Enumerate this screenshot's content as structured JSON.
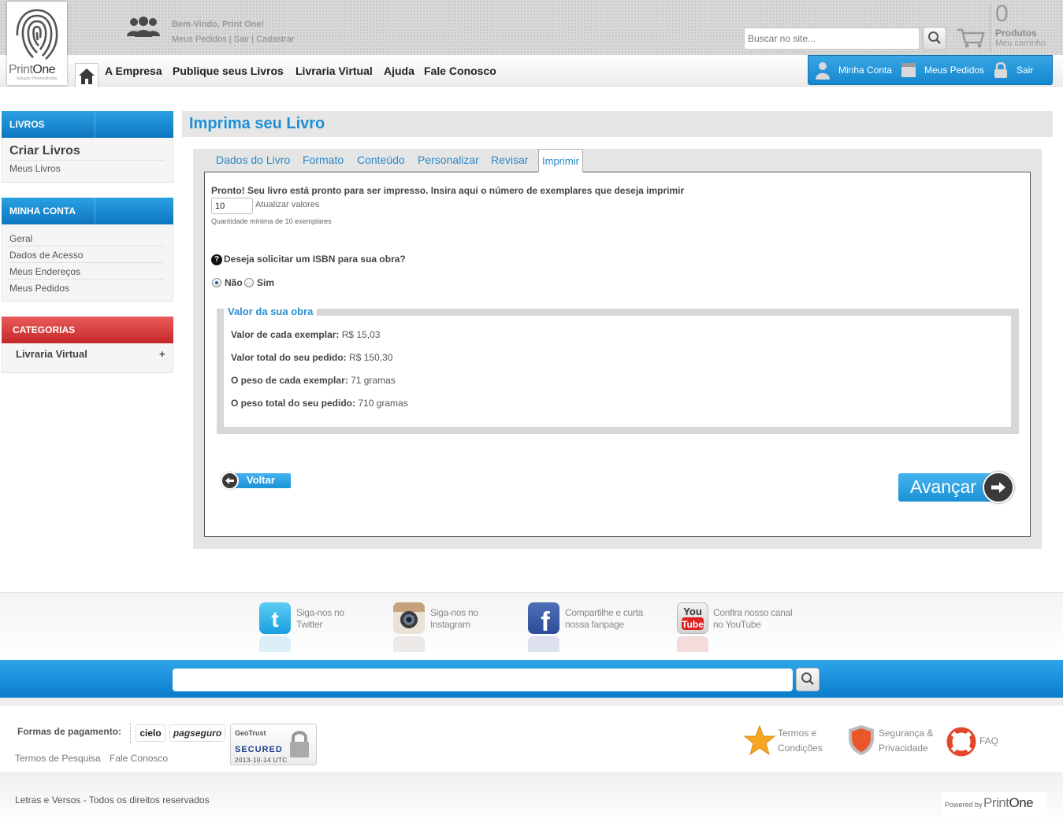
{
  "header": {
    "logo_text_1": "Print",
    "logo_text_2": "One",
    "logo_tagline": "Solução Personalizada",
    "welcome": "Bem-Vindo, Print One!",
    "user_links": "Meus Pedidos | Sair | Cadastrar",
    "search_placeholder": "Buscar no site...",
    "cart_count": "0",
    "cart_label": "Produtos",
    "cart_sub": "Meu carrinho",
    "menu": [
      "A Empresa",
      "Publique seus Livros",
      "Livraria Virtual",
      "Ajuda",
      "Fale Conosco"
    ],
    "account": {
      "my_account": "Minha Conta",
      "my_orders": "Meus Pedidos",
      "logout": "Sair"
    },
    "accent_color": "#1e8fd4"
  },
  "sidebar": {
    "livros": {
      "title": "LIVROS",
      "items": [
        "Criar Livros",
        "Meus Livros"
      ]
    },
    "minha_conta": {
      "title": "MINHA CONTA",
      "items": [
        "Geral",
        "Dados de Acesso",
        "Meus Endereços",
        "Meus Pedidos"
      ]
    },
    "categorias": {
      "title": "CATEGORIAS",
      "items": [
        "Livraria Virtual"
      ],
      "expand_symbol": "+"
    }
  },
  "main": {
    "title": "Imprima seu Livro",
    "tabs": [
      "Dados do Livro",
      "Formato",
      "Conteúdo",
      "Personalizar",
      "Revisar",
      "Imprimir"
    ],
    "active_tab": "Imprimir",
    "ready_text": "Pronto! Seu livro está pronto para ser impresso. Insira aqui o número de exemplares que deseja imprimir",
    "quantity": "10",
    "update_label": "Atualizar valores",
    "min_note": "Quantidade mínima de 10 exemplares",
    "isbn_question": "Deseja solicitar um ISBN para sua obra?",
    "isbn_options": [
      "Não",
      "Sim"
    ],
    "isbn_selected": "Não",
    "values": {
      "legend": "Valor da sua obra",
      "rows": [
        {
          "label": "Valor de cada exemplar:",
          "value": "R$ 15,03"
        },
        {
          "label": "Valor total do seu pedido:",
          "value": "R$ 150,30"
        },
        {
          "label": "O peso de cada exemplar:",
          "value": "71 gramas"
        },
        {
          "label": "O peso total do seu pedido:",
          "value": "710 gramas"
        }
      ]
    },
    "back_label": "Voltar",
    "next_label": "Avançar"
  },
  "footer": {
    "social": [
      {
        "line1": "Siga-nos no",
        "line2": "Twitter",
        "icon": "twitter-icon"
      },
      {
        "line1": "Siga-nos no",
        "line2": "Instagram",
        "icon": "instagram-icon"
      },
      {
        "line1": "Compartilhe e curta",
        "line2": "nossa fanpage",
        "icon": "facebook-icon"
      },
      {
        "line1": "Confira nosso canal",
        "line2": "no YouTube",
        "icon": "youtube-icon"
      }
    ],
    "payment_label": "Formas de pagamento:",
    "payment_logos": [
      "cielo",
      "pagseguro"
    ],
    "geotrust": {
      "brand": "GeoTrust",
      "secured": "SECURED",
      "date": "2013-10-14 UTC"
    },
    "links": [
      "Termos de Pesquisa",
      "Fale Conosco"
    ],
    "info": [
      {
        "line1": "Termos e",
        "line2": "Condições"
      },
      {
        "line1": "Segurança &",
        "line2": "Privacidade"
      },
      {
        "line1": "FAQ",
        "line2": ""
      }
    ],
    "copyright": "Letras e Versos - Todos os direitos reservados",
    "powered_by": "Powered by",
    "powered_logo_1": "Print",
    "powered_logo_2": "One"
  }
}
